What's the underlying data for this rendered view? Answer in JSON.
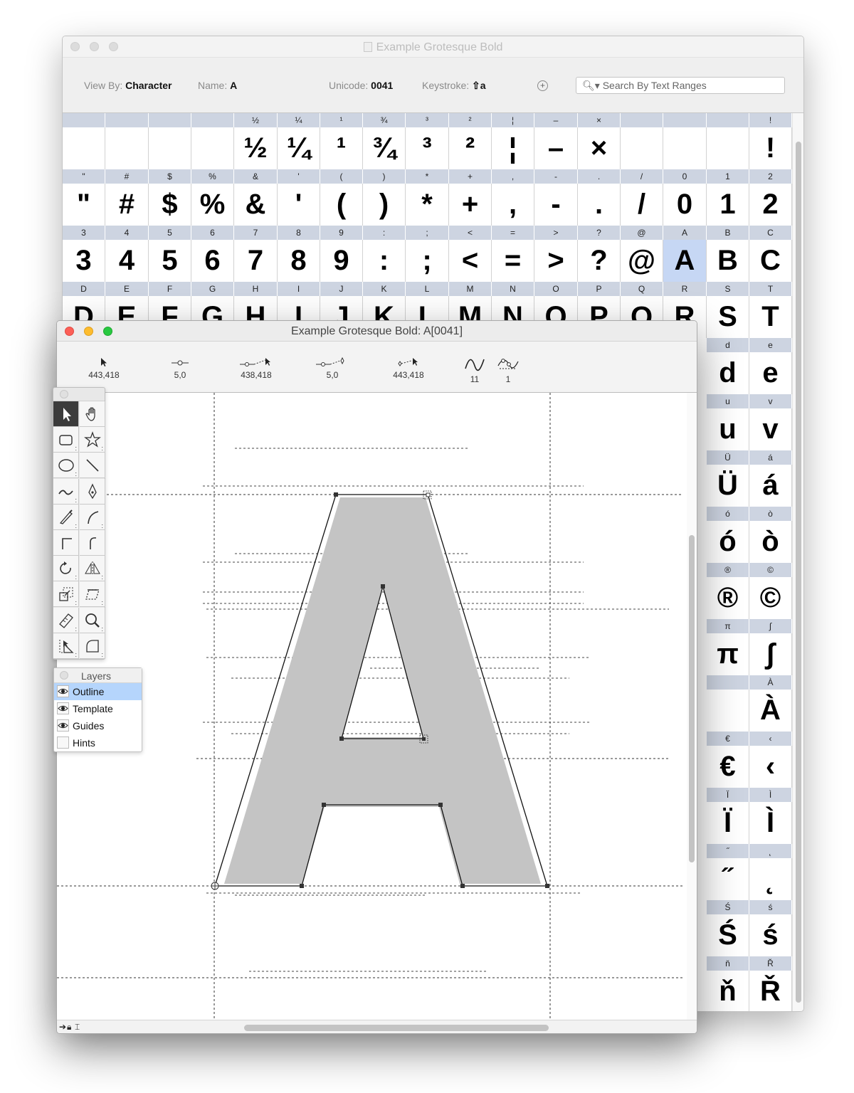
{
  "overview": {
    "title": "Example Grotesque Bold",
    "view_by_label": "View By:",
    "view_by_value": "Character",
    "name_label": "Name:",
    "name_value": "A",
    "unicode_label": "Unicode:",
    "unicode_value": "0041",
    "keystroke_label": "Keystroke:",
    "keystroke_value": "⇧a",
    "search_placeholder": "Search By Text Ranges",
    "selected_glyph": "A",
    "grid_rows": [
      [
        "",
        "",
        "",
        "",
        "½",
        "¼",
        "¹",
        "¾",
        "³",
        "²",
        "¦",
        "–",
        "×",
        "",
        "",
        "",
        "!"
      ],
      [
        "\"",
        "#",
        "$",
        "%",
        "&",
        "'",
        "(",
        ")",
        "*",
        "+",
        ",",
        "-",
        ".",
        "/",
        "0",
        "1",
        "2"
      ],
      [
        "3",
        "4",
        "5",
        "6",
        "7",
        "8",
        "9",
        ":",
        ";",
        "<",
        "=",
        ">",
        "?",
        "@",
        "A",
        "B",
        "C"
      ],
      [
        "D",
        "E",
        "F",
        "G",
        "H",
        "I",
        "J",
        "K",
        "L",
        "M",
        "N",
        "O",
        "P",
        "Q",
        "R",
        "S",
        "T"
      ]
    ],
    "right_cells": [
      [
        "d",
        "e"
      ],
      [
        "u",
        "v"
      ],
      [
        "Ü",
        "á"
      ],
      [
        "ó",
        "ò"
      ],
      [
        "®",
        "©"
      ],
      [
        "π",
        "∫"
      ],
      [
        "",
        "À"
      ],
      [
        "€",
        "‹"
      ],
      [
        "Ï",
        "Ì"
      ],
      [
        "˝",
        "˛"
      ],
      [
        "Ś",
        "ś"
      ],
      [
        "ň",
        "Ř"
      ]
    ]
  },
  "editor": {
    "title": "Example Grotesque Bold: A[0041]",
    "toolbar": [
      {
        "icon": "pointer-icon",
        "value": "443,418"
      },
      {
        "icon": "point-offset-icon",
        "value": "5,0"
      },
      {
        "icon": "pointer-distance-icon",
        "value": "438,418"
      },
      {
        "icon": "curve-offset-icon",
        "value": "5,0"
      },
      {
        "icon": "point-position-icon",
        "value": "443,418"
      },
      {
        "icon": "contour-count-icon",
        "value": "11"
      },
      {
        "icon": "selected-points-icon",
        "value": "1"
      }
    ]
  },
  "tools": [
    "pointer-tool-icon",
    "hand-tool-icon",
    "rectangle-tool-icon",
    "star-tool-icon",
    "ellipse-tool-icon",
    "line-tool-icon",
    "freehand-tool-icon",
    "pen-tool-icon",
    "knife-tool-icon",
    "curve-point-tool-icon",
    "corner-point-tool-icon",
    "tangent-point-tool-icon",
    "rotate-tool-icon",
    "reflect-tool-icon",
    "scale-tool-icon",
    "skew-tool-icon",
    "measure-tool-icon",
    "zoom-tool-icon",
    "perspective-tool-icon",
    "shape-tool-icon"
  ],
  "layers": {
    "title": "Layers",
    "items": [
      {
        "label": "Outline",
        "visible": true,
        "selected": true
      },
      {
        "label": "Template",
        "visible": true,
        "selected": false
      },
      {
        "label": "Guides",
        "visible": true,
        "selected": false
      },
      {
        "label": "Hints",
        "visible": false,
        "selected": false
      }
    ]
  },
  "colors": {
    "selection": "#c6d7f4",
    "header_band": "#cdd4e1",
    "template_fill": "#c4c4c4",
    "layer_selection": "#b5d5fc"
  }
}
